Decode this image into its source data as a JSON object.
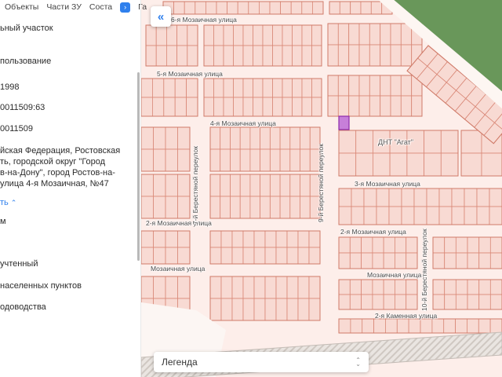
{
  "colors": {
    "accent": "#2f80ed",
    "map_bg": "#fdeeea",
    "parcel_fill": "#f8dad3",
    "parcel_stroke": "#d98877",
    "block_stroke": "#cf7a68",
    "green_area": "#69975a",
    "road": "#fdf6f2",
    "selected_fill": "#c77fd9",
    "selected_stroke": "#8e2bab",
    "hatch_bg": "#eae5e1",
    "hatch_line": "#cfc8c2",
    "pale_area": "#fcf6f3"
  },
  "tabs": {
    "items": [
      {
        "label": "Объекты"
      },
      {
        "label": "Части ЗУ"
      },
      {
        "label": "Соста"
      },
      {
        "label": "Га"
      }
    ],
    "more_button": "›"
  },
  "sidebar": {
    "items": [
      {
        "text": "ьный участок"
      },
      {
        "text": "пользование"
      },
      {
        "text": "1998"
      },
      {
        "text": "0011509:63"
      },
      {
        "text": "0011509"
      },
      {
        "text": "йская Федерация, Ростовская"
      },
      {
        "text": "ть, городской округ \"Город"
      },
      {
        "text": "в-на-Дону\", город Ростов-на-"
      },
      {
        "text": "улица 4-я Мозаичная, №47"
      },
      {
        "text": "ть"
      },
      {
        "text": "м"
      },
      {
        "text": "учтенный"
      },
      {
        "text": "населенных пунктов"
      },
      {
        "text": "одоводства"
      }
    ],
    "collapse_caret": "⌃"
  },
  "map": {
    "collapse_button": "«",
    "legend_label": "Легенда",
    "area_label": "ДНТ \"Агат\"",
    "streets": [
      {
        "label": "6-я Мозаичная улица"
      },
      {
        "label": "5-я Мозаичная улица"
      },
      {
        "label": "4-я Мозаичная улица"
      },
      {
        "label": "3-я Мозаичная улица"
      },
      {
        "label": "2-я Мозаичная улица"
      },
      {
        "label": "2-я Мозаичная улица"
      },
      {
        "label": "Мозаичная улица"
      },
      {
        "label": "Мозаичная улица"
      },
      {
        "label": "2-я Каменная улица"
      },
      {
        "label": "9-й Берестяной переулок"
      },
      {
        "label": "7-й Берестяной переулок"
      },
      {
        "label": "10-й Берестяной переулок"
      }
    ]
  }
}
